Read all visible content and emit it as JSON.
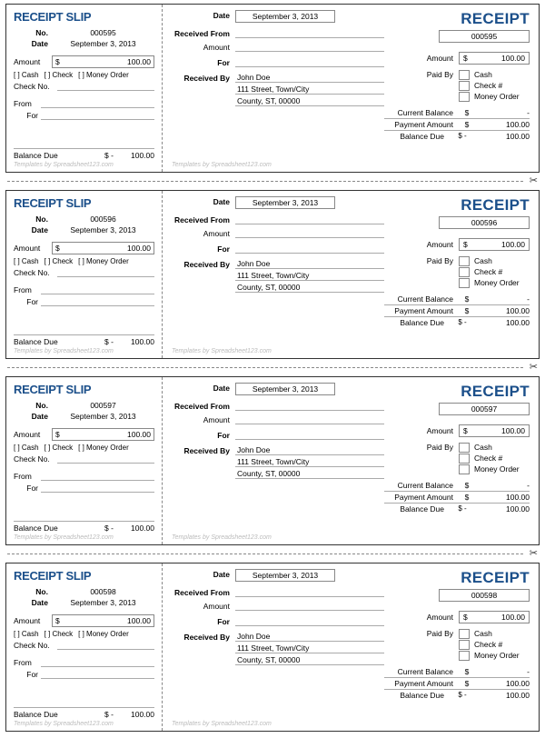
{
  "labels": {
    "slip_title": "RECEIPT SLIP",
    "receipt_title": "RECEIPT",
    "no": "No.",
    "date": "Date",
    "amount": "Amount",
    "cash": "[ ] Cash",
    "check": "[ ] Check",
    "money_order": "[ ] Money Order",
    "check_no": "Check No.",
    "from": "From",
    "for": "For",
    "balance_due": "Balance Due",
    "footer": "Templates by Spreadsheet123.com",
    "received_from": "Received From",
    "received_by": "Received By",
    "paid_by": "Paid By",
    "paid_cash": "Cash",
    "paid_check": "Check #",
    "paid_mo": "Money Order",
    "current_balance": "Current Balance",
    "payment_amount": "Payment Amount",
    "currency": "$",
    "dash": "$   -"
  },
  "receipts": [
    {
      "no": "000595",
      "date": "September 3, 2013",
      "amount": "100.00",
      "received_by": "John Doe",
      "addr1": "111 Street, Town/City",
      "addr2": "County, ST, 00000",
      "current_balance": "-",
      "payment_amount": "100.00",
      "balance_due": "100.00",
      "slip_balance": "100.00"
    },
    {
      "no": "000596",
      "date": "September 3, 2013",
      "amount": "100.00",
      "received_by": "John Doe",
      "addr1": "111 Street, Town/City",
      "addr2": "County, ST, 00000",
      "current_balance": "-",
      "payment_amount": "100.00",
      "balance_due": "100.00",
      "slip_balance": "100.00"
    },
    {
      "no": "000597",
      "date": "September 3, 2013",
      "amount": "100.00",
      "received_by": "John Doe",
      "addr1": "111 Street, Town/City",
      "addr2": "County, ST, 00000",
      "current_balance": "-",
      "payment_amount": "100.00",
      "balance_due": "100.00",
      "slip_balance": "100.00"
    },
    {
      "no": "000598",
      "date": "September 3, 2013",
      "amount": "100.00",
      "received_by": "John Doe",
      "addr1": "111 Street, Town/City",
      "addr2": "County, ST, 00000",
      "current_balance": "-",
      "payment_amount": "100.00",
      "balance_due": "100.00",
      "slip_balance": "100.00"
    }
  ]
}
